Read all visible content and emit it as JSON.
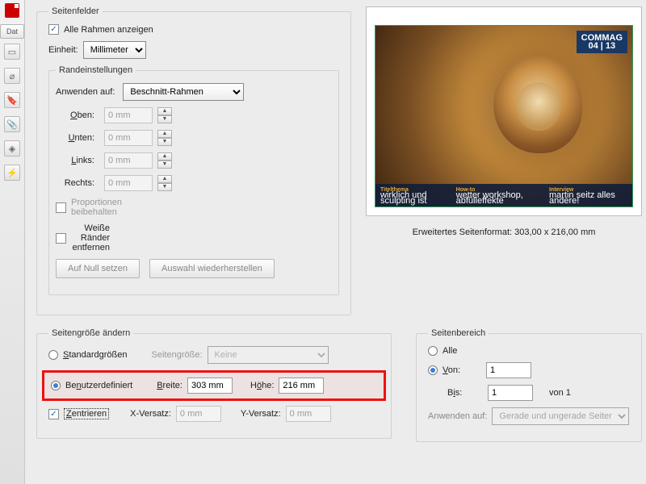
{
  "sidebar": {
    "tab_label": "Dat"
  },
  "boxes": {
    "legend": "Seitenfelder",
    "show_all_label": "Alle Rahmen anzeigen",
    "show_all_checked": true,
    "unit_label": "Einheit:",
    "unit_value": "Millimeter",
    "margins": {
      "legend": "Randeinstellungen",
      "apply_to_label": "Anwenden auf:",
      "apply_to_value": "Beschnitt-Rahmen",
      "top_label": "Oben:",
      "bottom_label": "Unten:",
      "left_label": "Links:",
      "right_label": "Rechts:",
      "value": "0 mm",
      "proportions_label": "Proportionen beibehalten",
      "white_margins_label": "Weiße Ränder entfernen",
      "reset_label": "Auf Null setzen",
      "restore_label": "Auswahl wiederherstellen"
    }
  },
  "preview": {
    "badge_line1": "COMMAG",
    "badge_line2": "04 | 13",
    "cols": [
      {
        "h": "Titelthema",
        "t": "wirklich und sculpting ist"
      },
      {
        "h": "How-to",
        "t": "wetter workshop, abfülleffekte"
      },
      {
        "h": "Interview",
        "t": "martin seitz alles andere!"
      }
    ],
    "extended_label": "Erweitertes Seitenformat: 303,00 x 216,00 mm"
  },
  "changesize": {
    "legend": "Seitengröße ändern",
    "standard_label": "Standardgrößen",
    "pagesize_label": "Seitengröße:",
    "pagesize_value": "Keine",
    "custom_label": "Benutzerdefiniert",
    "width_label": "Breite:",
    "width_value": "303 mm",
    "height_label": "Höhe:",
    "height_value": "216 mm",
    "center_label": "Zentrieren",
    "center_checked": true,
    "xoffset_label": "X-Versatz:",
    "yoffset_label": "Y-Versatz:",
    "offset_value": "0 mm"
  },
  "range": {
    "legend": "Seitenbereich",
    "all_label": "Alle",
    "from_label": "Von:",
    "from_value": "1",
    "to_label": "Bis:",
    "to_value": "1",
    "of_label": "von 1",
    "apply_to_label": "Anwenden auf:",
    "apply_to_value": "Gerade und ungerade Seiten"
  }
}
